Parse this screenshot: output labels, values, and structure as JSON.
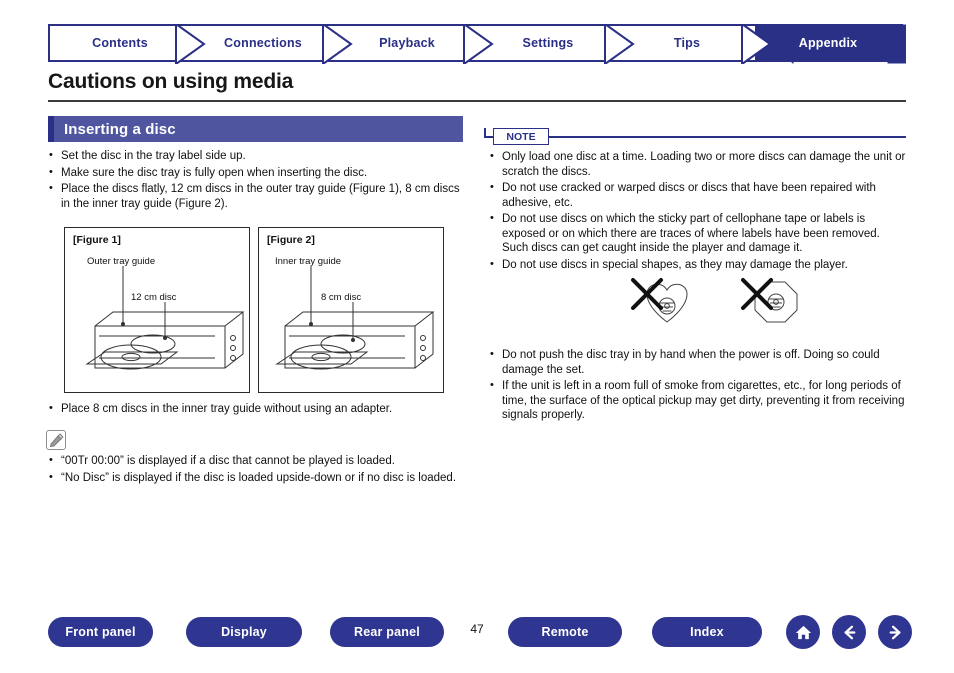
{
  "tabs": [
    {
      "label": "Contents",
      "active": false,
      "name": "tab-contents"
    },
    {
      "label": "Connections",
      "active": false,
      "name": "tab-connections"
    },
    {
      "label": "Playback",
      "active": false,
      "name": "tab-playback"
    },
    {
      "label": "Settings",
      "active": false,
      "name": "tab-settings"
    },
    {
      "label": "Tips",
      "active": false,
      "name": "tab-tips"
    },
    {
      "label": "Appendix",
      "active": true,
      "name": "tab-appendix"
    }
  ],
  "page": {
    "title": "Cautions on using media",
    "number": "47"
  },
  "left": {
    "section_heading": "Inserting a disc",
    "bullets": [
      "Set the disc in the tray label side up.",
      "Make sure the disc tray is fully open when inserting the disc.",
      "Place the discs flatly, 12 cm discs in the outer tray guide (Figure 1), 8 cm discs in the inner tray guide (Figure 2)."
    ],
    "figures": [
      {
        "label": "[Figure 1]",
        "caption_guide": "Outer tray guide",
        "caption_disc": "12 cm disc"
      },
      {
        "label": "[Figure 2]",
        "caption_guide": "Inner tray guide",
        "caption_disc": "8 cm disc"
      }
    ],
    "bullet_after": "Place 8 cm discs in the inner tray guide without using an adapter.",
    "tips": [
      "“00Tr  00:00” is displayed if a disc that cannot be played is loaded.",
      "“No Disc” is displayed if the disc is loaded upside-down or if no disc is loaded."
    ]
  },
  "right": {
    "note_badge": "NOTE",
    "notes_top": [
      "Only load one disc at a time. Loading two or more discs can damage the unit or scratch the discs.",
      "Do not use cracked or warped discs or discs that have been repaired with adhesive, etc.",
      "Do not use discs on which the sticky part of cellophane tape or labels is exposed or on which there are traces of where labels have been removed. Such discs can get caught inside the player and damage it.",
      "Do not use discs in special shapes, as they may damage the player."
    ],
    "notes_bottom": [
      "Do not push the disc tray in by hand when the power is off. Doing so could damage the set.",
      "If the unit is left in a room full of smoke from cigarettes, etc., for long periods of time, the surface of the optical pickup may get dirty, preventing it from receiving signals properly."
    ]
  },
  "footer": {
    "buttons": [
      {
        "label": "Front panel",
        "name": "footer-front-panel-button"
      },
      {
        "label": "Display",
        "name": "footer-display-button"
      },
      {
        "label": "Rear panel",
        "name": "footer-rear-panel-button"
      },
      {
        "label": "Remote",
        "name": "footer-remote-button"
      },
      {
        "label": "Index",
        "name": "footer-index-button"
      }
    ],
    "icons": [
      "home-icon",
      "back-arrow-icon",
      "forward-arrow-icon"
    ]
  },
  "colors": {
    "brand": "#2b3087",
    "heading_bar": "#4f569f",
    "tab_text": "#2a2f86"
  }
}
